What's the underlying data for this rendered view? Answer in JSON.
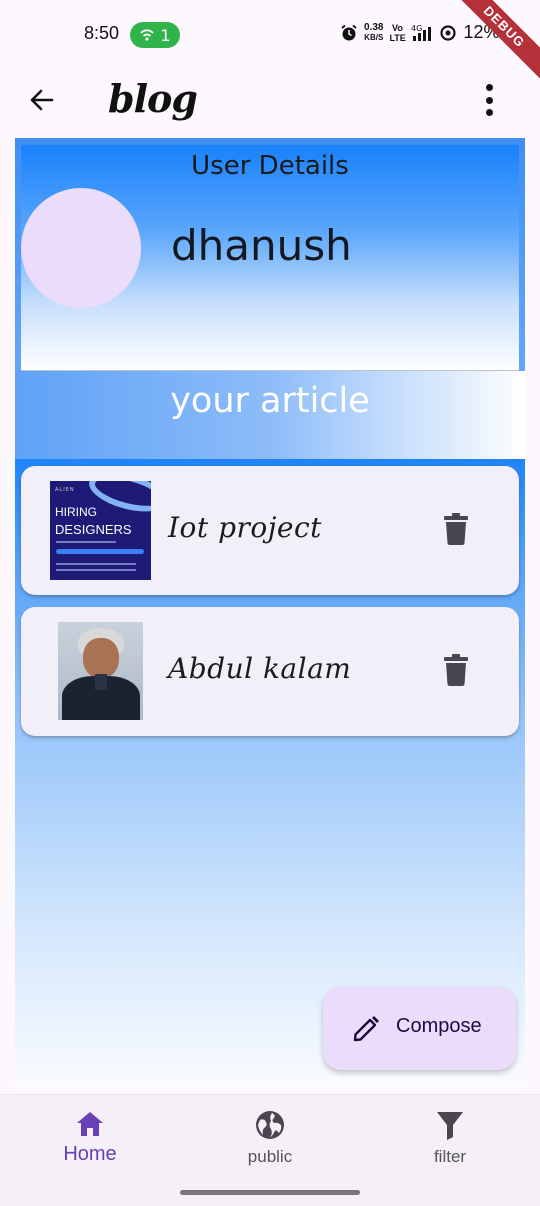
{
  "status_bar": {
    "time": "8:50",
    "hotspot_count": "1",
    "net_speed_value": "0.38",
    "net_speed_unit": "KB/S",
    "volte_label": "Vo LTE",
    "network_label": "4G",
    "battery_percent": "12%",
    "debug_banner": "DEBUG"
  },
  "app_bar": {
    "title": "blog",
    "back_icon": "arrow-left-icon",
    "menu_icon": "more-vert-icon"
  },
  "user_details": {
    "heading": "User Details",
    "username": "dhanush"
  },
  "articles_section": {
    "heading": "your article",
    "items": [
      {
        "title": "Iot project",
        "thumbnail_text": [
          "HIRING",
          "DESIGNERS"
        ],
        "thumbnail_brand": "ALIEN"
      },
      {
        "title": "Abdul kalam"
      }
    ]
  },
  "fab": {
    "label": "Compose",
    "icon": "pencil-icon"
  },
  "bottom_nav": {
    "items": [
      {
        "label": "Home",
        "icon": "home-icon",
        "active": true
      },
      {
        "label": "public",
        "icon": "globe-icon",
        "active": false
      },
      {
        "label": "filter",
        "icon": "filter-icon",
        "active": false
      }
    ]
  },
  "colors": {
    "accent": "#6740b5",
    "fab_background": "#ecdcfc",
    "card_background": "#f3eff8",
    "gradient_blue": "#1a82fb"
  }
}
